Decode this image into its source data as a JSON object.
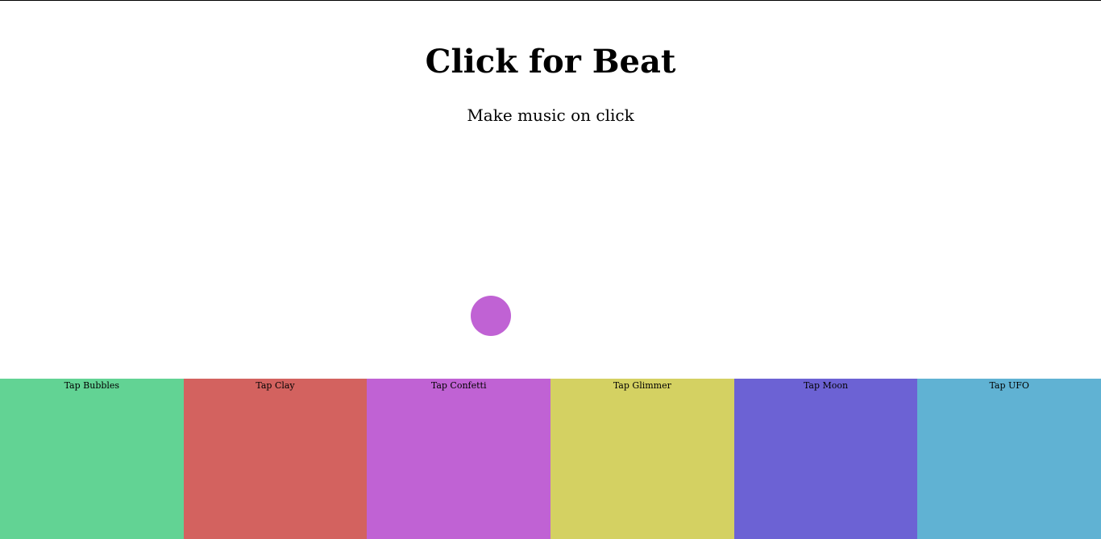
{
  "header": {
    "title": "Click for Beat",
    "subtitle": "Make music on click"
  },
  "beat_dot": {
    "color": "#c062d4"
  },
  "pads": [
    {
      "id": "bubbles",
      "label": "Tap Bubbles",
      "color": "#62d394"
    },
    {
      "id": "clay",
      "label": "Tap Clay",
      "color": "#d3625f"
    },
    {
      "id": "confetti",
      "label": "Tap Confetti",
      "color": "#c062d4"
    },
    {
      "id": "glimmer",
      "label": "Tap Glimmer",
      "color": "#d4d162"
    },
    {
      "id": "moon",
      "label": "Tap Moon",
      "color": "#6c62d4"
    },
    {
      "id": "ufo",
      "label": "Tap UFO",
      "color": "#60b2d3"
    }
  ]
}
